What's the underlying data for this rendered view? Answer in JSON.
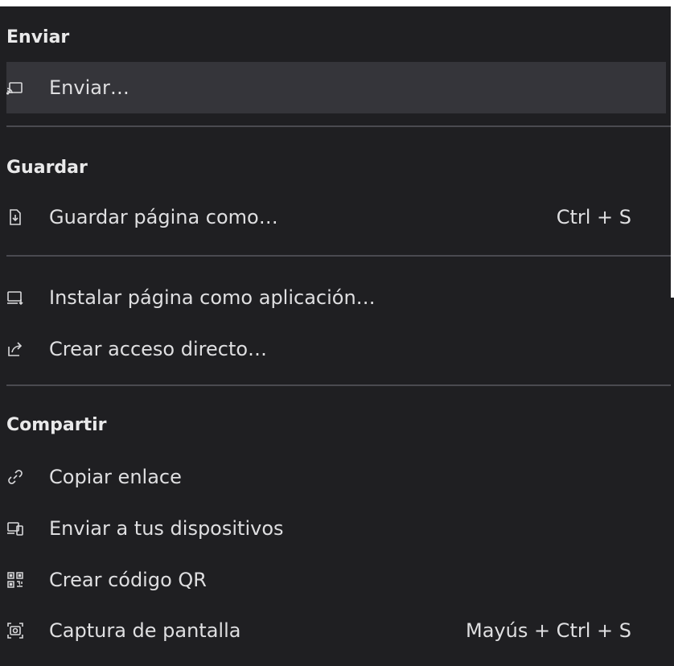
{
  "sections": {
    "send": {
      "header": "Enviar",
      "items": [
        {
          "label": "Enviar…",
          "icon": "cast-icon",
          "shortcut": ""
        }
      ]
    },
    "save": {
      "header": "Guardar",
      "items": [
        {
          "label": "Guardar página como…",
          "icon": "save-page-icon",
          "shortcut": "Ctrl + S"
        },
        {
          "label": "Instalar página como aplicación…",
          "icon": "install-app-icon",
          "shortcut": ""
        },
        {
          "label": "Crear acceso directo…",
          "icon": "shortcut-icon",
          "shortcut": ""
        }
      ]
    },
    "share": {
      "header": "Compartir",
      "items": [
        {
          "label": "Copiar enlace",
          "icon": "link-icon",
          "shortcut": ""
        },
        {
          "label": "Enviar a tus dispositivos",
          "icon": "devices-icon",
          "shortcut": ""
        },
        {
          "label": "Crear código QR",
          "icon": "qr-code-icon",
          "shortcut": ""
        },
        {
          "label": "Captura de pantalla",
          "icon": "screenshot-icon",
          "shortcut": "Mayús + Ctrl + S"
        }
      ]
    }
  },
  "colors": {
    "background": "#1f1f22",
    "hover": "#35353a",
    "text": "#dfdfe1",
    "separator": "#4a4a50"
  }
}
